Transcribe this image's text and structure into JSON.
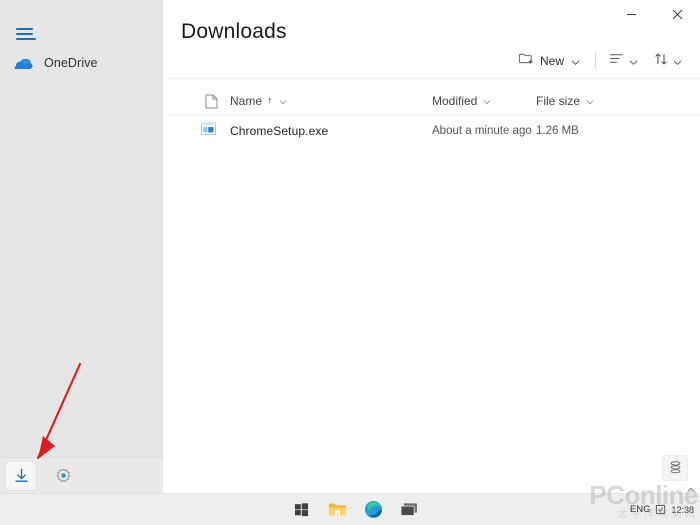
{
  "window": {
    "title": "Downloads",
    "minimize_label": "Minimize",
    "close_label": "Close"
  },
  "sidebar": {
    "menu_label": "Menu",
    "onedrive": {
      "label": "OneDrive",
      "icon": "onedrive-cloud-icon"
    },
    "bottom_buttons": [
      {
        "name": "downloads-button",
        "icon": "download-arrow-icon",
        "label": "Downloads",
        "active": true
      },
      {
        "name": "settings-button",
        "icon": "gear-icon",
        "label": "Settings",
        "active": false
      }
    ]
  },
  "toolbar": {
    "new_label": "New",
    "new_icon": "new-folder-icon",
    "view_icon": "view-list-icon",
    "sort_icon": "sort-arrows-icon",
    "chevron_icon": "chevron-down-icon"
  },
  "list": {
    "columns": {
      "icon": "file-type-icon",
      "name": "Name",
      "sort_indicator": "↑",
      "modified": "Modified",
      "file_size": "File size"
    },
    "rows": [
      {
        "icon": "exe-app-icon",
        "name": "ChromeSetup.exe",
        "modified": "About a minute ago",
        "size": "1.26 MB"
      }
    ]
  },
  "storage_button": {
    "label": "Storage",
    "icon": "storage-stack-icon"
  },
  "taskbar": {
    "apps": [
      {
        "name": "start-button",
        "icon": "windows-logo-icon",
        "label": "Start"
      },
      {
        "name": "file-explorer-button",
        "icon": "folder-icon",
        "label": "File Explorer"
      },
      {
        "name": "edge-button",
        "icon": "edge-browser-icon",
        "label": "Microsoft Edge"
      },
      {
        "name": "task-view-button",
        "icon": "task-view-icon",
        "label": "Task View"
      }
    ],
    "tray": {
      "language": "ENG",
      "time": "12:38",
      "chevron_icon": "chevron-up-icon",
      "notification_icon": "notification-icon"
    }
  },
  "annotation": {
    "arrow_color": "#d81e1e",
    "arrow_name": "red-pointer-arrow"
  },
  "watermark": {
    "main": "PConline",
    "sub": "太平洋电脑网"
  },
  "colors": {
    "sidebar_bg": "#e6e6e6",
    "content_bg": "#ffffff",
    "accent_blue": "#1b6ec2",
    "taskbar_bg": "#eeeeee",
    "annotation_red": "#d81e1e"
  }
}
